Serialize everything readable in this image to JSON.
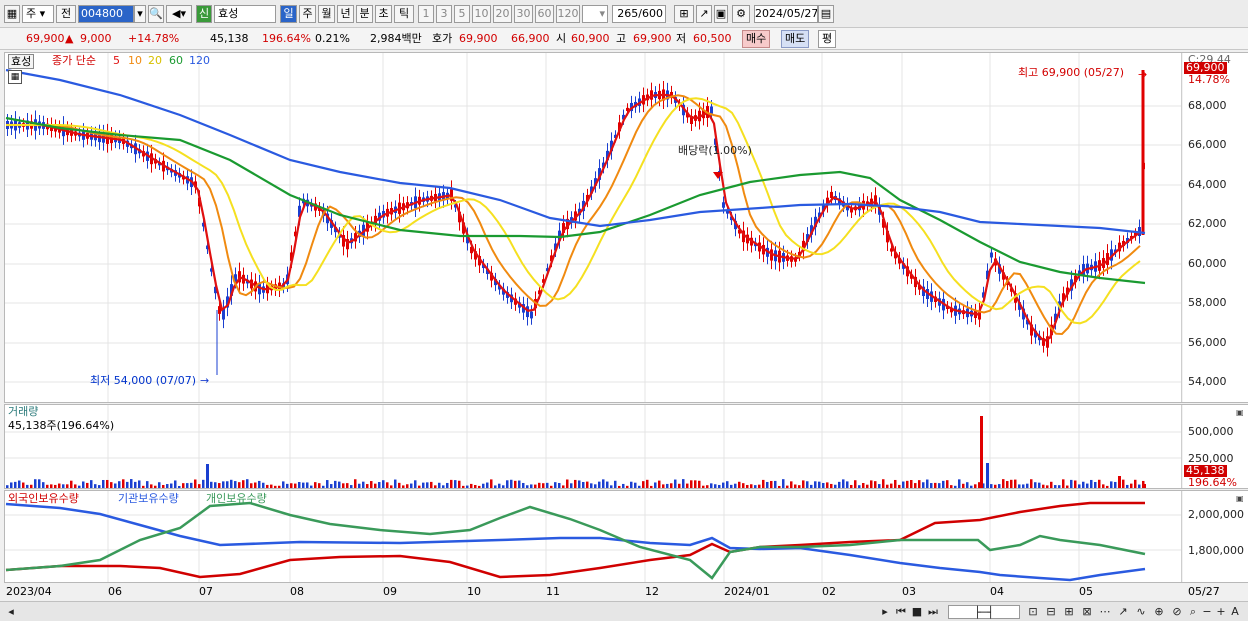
{
  "toolbar": {
    "market": "주",
    "prev_label": "전",
    "code": "004800",
    "search_icon": "search-icon",
    "sound_icon": "speaker-icon",
    "new_badge": "신",
    "name": "효성",
    "periods": [
      "일",
      "주",
      "월",
      "년",
      "분",
      "초",
      "틱"
    ],
    "minutes": [
      "1",
      "3",
      "5",
      "10",
      "20",
      "30",
      "60",
      "120"
    ],
    "count": "265",
    "total": "/600",
    "date": "2024/05/27"
  },
  "quote": {
    "price": "69,900",
    "change": "9,000",
    "change_pct": "+14.78%",
    "volume": "45,138",
    "vol_pct": "196.64%",
    "turnover": "0.21%",
    "amount": "2,984백만",
    "ask_label": "호가",
    "ask": "69,900",
    "bid": "66,900",
    "open_label": "시",
    "open": "60,900",
    "high_label": "고",
    "high": "69,900",
    "low_label": "저",
    "low": "60,500",
    "buy_label": "매수",
    "sell_label": "매도",
    "avg_label": "평"
  },
  "legend": {
    "name": "효성",
    "title": "종가 단순",
    "ma": [
      "5",
      "10",
      "20",
      "60",
      "120"
    ]
  },
  "annotations": {
    "high": "최고 69,900 (05/27)",
    "low": "최저 54,000 (07/07)",
    "dividend": "배당락(1.00%)"
  },
  "price_axis": [
    "68,000",
    "66,000",
    "64,000",
    "62,000",
    "60,000",
    "58,000",
    "56,000",
    "54,000"
  ],
  "price_axis_top": "C:29.44",
  "price_tag": "69,900",
  "price_tag_pct": "14.78%",
  "volume": {
    "title": "거래량",
    "value": "45,138주(196.64%)",
    "axis": [
      "500,000",
      "250,000"
    ],
    "tag": "45,138",
    "tag_pct": "196.64%"
  },
  "holdings": {
    "foreign": "외국인보유수량",
    "inst": "기관보유수량",
    "indiv": "개인보유수량",
    "axis": [
      "2,000,000",
      "1,800,000"
    ]
  },
  "xaxis": [
    "2023/04",
    "06",
    "07",
    "08",
    "09",
    "10",
    "11",
    "12",
    "2024/01",
    "02",
    "03",
    "04",
    "05"
  ],
  "xaxis_end": "05/27",
  "colors": {
    "up": "#e00000",
    "down": "#1a3fd0",
    "ma5": "#e01010",
    "ma10": "#f08a10",
    "ma20": "#f5e020",
    "ma60": "#1a9a30",
    "ma120": "#2a5ae0",
    "foreign": "#d00000",
    "inst": "#2a5ae0",
    "indiv": "#3a9a5a"
  }
}
